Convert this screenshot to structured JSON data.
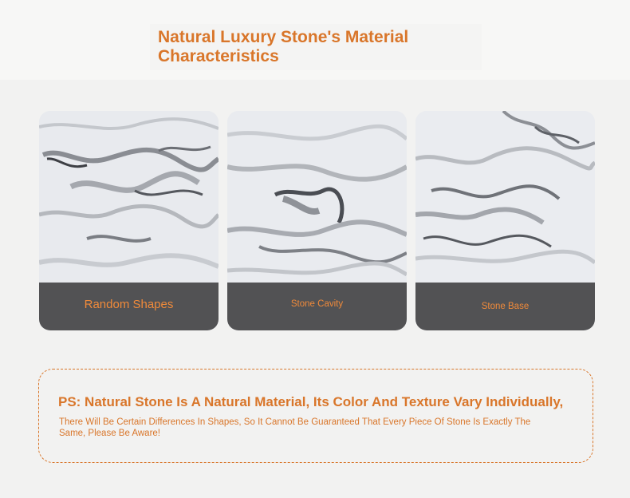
{
  "title": "Natural Luxury Stone's Material Characteristics",
  "cards": [
    {
      "label": "Random Shapes"
    },
    {
      "label": "Stone Cavity"
    },
    {
      "label": "Stone Base"
    }
  ],
  "notice": {
    "main": "PS: Natural Stone Is A Natural Material, Its Color And Texture Vary Individually,",
    "sub": "There Will Be Certain Differences In Shapes, So It Cannot Be Guaranteed That Every Piece Of Stone Is Exactly The Same, Please Be Aware!"
  },
  "colors": {
    "accent": "#d9762a",
    "label_text": "#f08a3a",
    "caption_band": "#464648",
    "background": "#f2f2f1"
  }
}
